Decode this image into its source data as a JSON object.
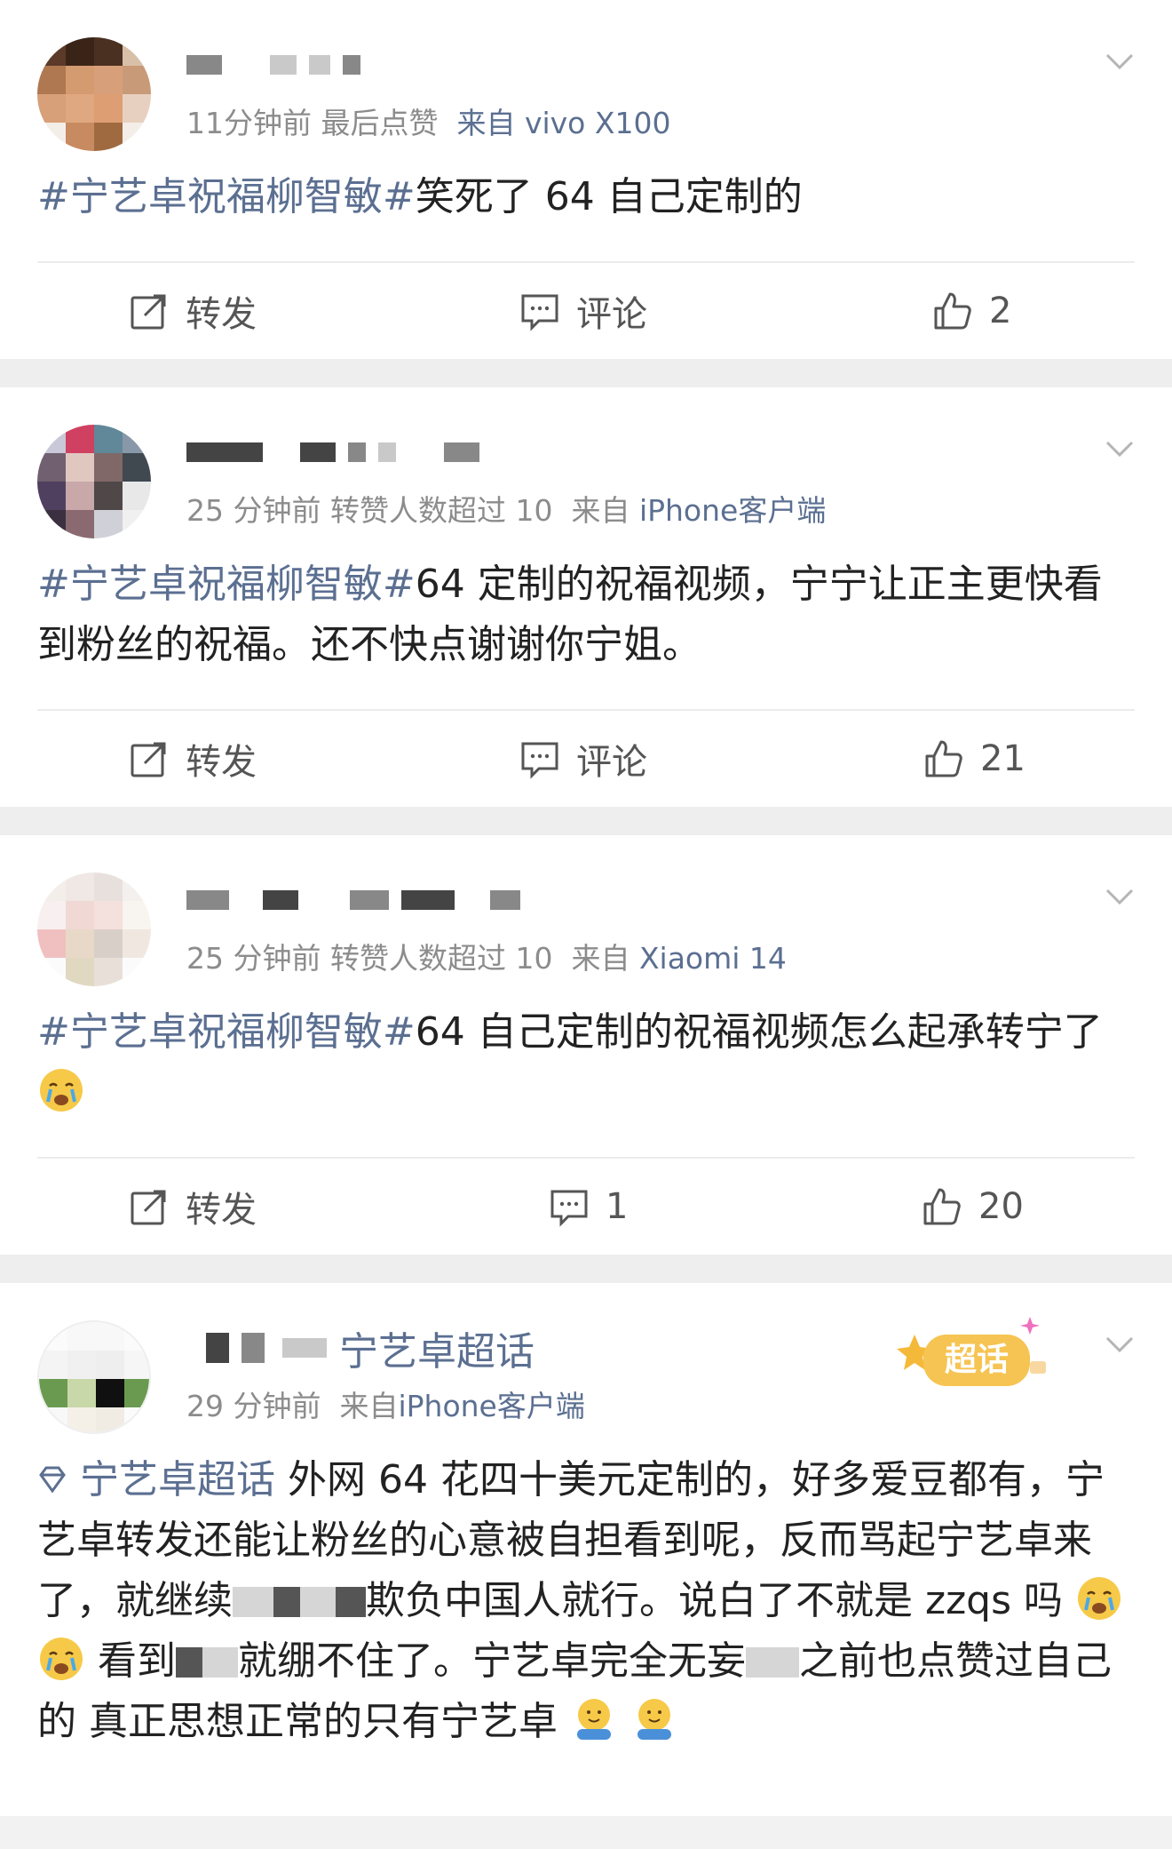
{
  "posts": [
    {
      "meta_time": "11分钟前 最后点赞",
      "meta_source": "来自 vivo X100",
      "topic": "#宁艺卓祝福柳智敏#",
      "text": "笑死了 64 自己定制的",
      "repost_label": "转发",
      "comment_label": "评论",
      "like_count": "2"
    },
    {
      "meta_time": "25 分钟前 转赞人数超过 10",
      "meta_from": "来自",
      "meta_source": "iPhone客户端",
      "topic": "#宁艺卓祝福柳智敏#",
      "text": "64 定制的祝福视频，宁宁让正主更快看到粉丝的祝福。还不快点谢谢你宁姐。",
      "repost_label": "转发",
      "comment_label": "评论",
      "like_count": "21"
    },
    {
      "meta_time": "25 分钟前 转赞人数超过 10",
      "meta_from": "来自",
      "meta_source": "Xiaomi 14",
      "topic": "#宁艺卓祝福柳智敏#",
      "text": "64 自己定制的祝福视频怎么起承转宁了",
      "repost_label": "转发",
      "comment_count": "1",
      "like_count": "20"
    },
    {
      "name_suffix": "宁艺卓超话",
      "meta_time": "29 分钟前",
      "meta_from": "来自",
      "meta_source": "iPhone客户端",
      "badge": "超话",
      "super_topic": "宁艺卓超话",
      "text_1": " 外网 64 花四十美元定制的，好多爱豆都有，宁艺卓转发还能让粉丝的心意被自担看到呢，反而骂起宁艺卓来了，就继续",
      "text_2": "欺负中国人就行。说白了不就是 zzqs 吗",
      "text_3": "看到",
      "text_4": "就绷不住了。宁艺卓完全无妄",
      "text_5": "之前也点赞过自己的 真正思想正常的只有宁艺卓"
    }
  ],
  "icons": {
    "repost": "repost-icon",
    "comment": "comment-icon",
    "like": "thumbs-up-icon",
    "chevron": "chevron-down-icon",
    "cry_emoji": "crying-emoji",
    "hug_emoji": "hug-emoji",
    "super_topic": "diamond-icon"
  },
  "colors": {
    "link": "#5b6f91",
    "meta": "#8c8c8c",
    "badge": "#f5b93a"
  }
}
